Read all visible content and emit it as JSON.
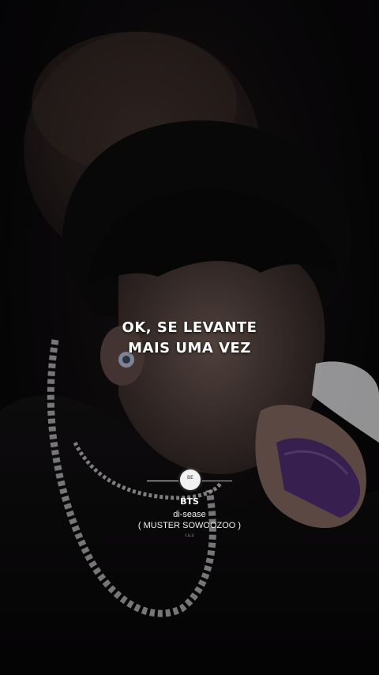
{
  "lyrics": {
    "line1": "OK, SE LEVANTE",
    "line2": "MAIS UMA VEZ"
  },
  "player": {
    "disc_label": "BE",
    "artist": "BTS",
    "song": "di-sease",
    "album": "( MUSTER SOWOOZOO )",
    "small_text": "r.u.s"
  },
  "colors": {
    "text": "#ffffff",
    "background": "#050406"
  }
}
